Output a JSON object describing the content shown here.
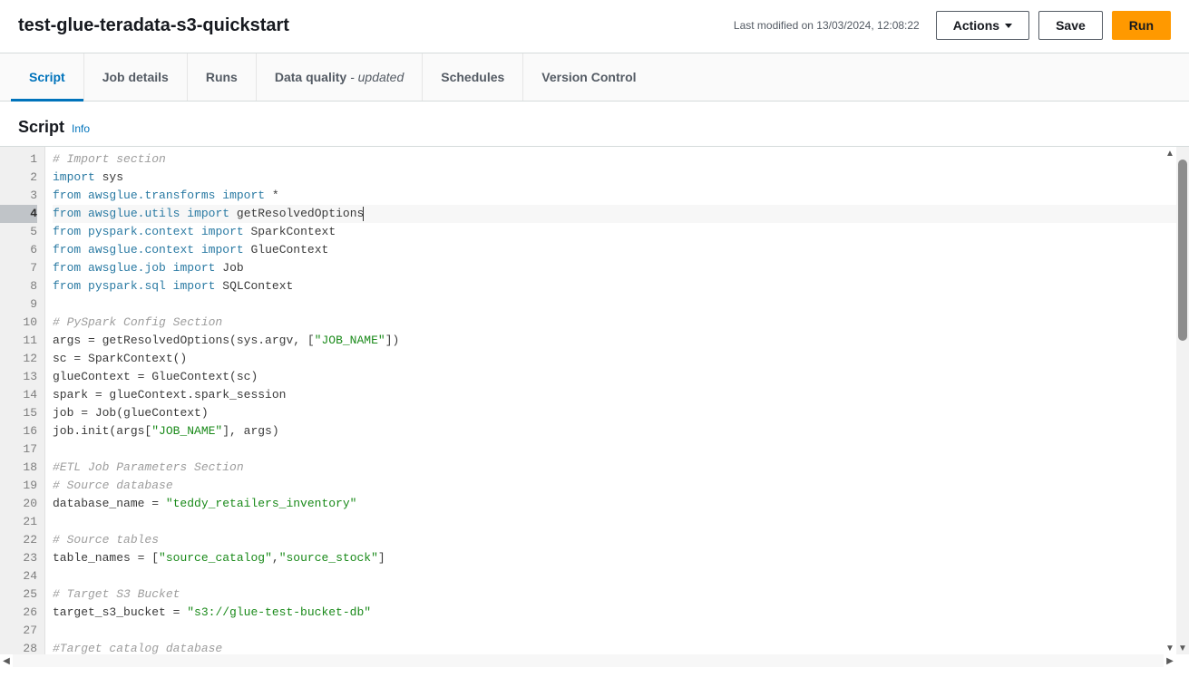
{
  "header": {
    "title": "test-glue-teradata-s3-quickstart",
    "last_modified": "Last modified on 13/03/2024, 12:08:22",
    "actions_label": "Actions",
    "save_label": "Save",
    "run_label": "Run"
  },
  "tabs": {
    "script": "Script",
    "job_details": "Job details",
    "runs": "Runs",
    "data_quality": "Data quality",
    "data_quality_suffix": " - updated",
    "schedules": "Schedules",
    "version_control": "Version Control"
  },
  "section": {
    "title": "Script",
    "info": "Info"
  },
  "editor": {
    "active_line": 4,
    "lines": [
      {
        "n": 1,
        "tokens": [
          {
            "c": "tok-comment",
            "t": "# Import section"
          }
        ]
      },
      {
        "n": 2,
        "tokens": [
          {
            "c": "tok-keyword",
            "t": "import"
          },
          {
            "c": "tok-op",
            "t": " "
          },
          {
            "c": "tok-ident",
            "t": "sys"
          }
        ]
      },
      {
        "n": 3,
        "tokens": [
          {
            "c": "tok-keyword",
            "t": "from"
          },
          {
            "c": "tok-op",
            "t": " "
          },
          {
            "c": "tok-module",
            "t": "awsglue.transforms"
          },
          {
            "c": "tok-op",
            "t": " "
          },
          {
            "c": "tok-keyword",
            "t": "import"
          },
          {
            "c": "tok-op",
            "t": " "
          },
          {
            "c": "tok-op",
            "t": "*"
          }
        ]
      },
      {
        "n": 4,
        "tokens": [
          {
            "c": "tok-keyword",
            "t": "from"
          },
          {
            "c": "tok-op",
            "t": " "
          },
          {
            "c": "tok-module",
            "t": "awsglue.utils"
          },
          {
            "c": "tok-op",
            "t": " "
          },
          {
            "c": "tok-keyword",
            "t": "import"
          },
          {
            "c": "tok-op",
            "t": " "
          },
          {
            "c": "tok-ident",
            "t": "getResolvedOptions"
          }
        ],
        "caret": true
      },
      {
        "n": 5,
        "tokens": [
          {
            "c": "tok-keyword",
            "t": "from"
          },
          {
            "c": "tok-op",
            "t": " "
          },
          {
            "c": "tok-module",
            "t": "pyspark.context"
          },
          {
            "c": "tok-op",
            "t": " "
          },
          {
            "c": "tok-keyword",
            "t": "import"
          },
          {
            "c": "tok-op",
            "t": " "
          },
          {
            "c": "tok-ident",
            "t": "SparkContext"
          }
        ]
      },
      {
        "n": 6,
        "tokens": [
          {
            "c": "tok-keyword",
            "t": "from"
          },
          {
            "c": "tok-op",
            "t": " "
          },
          {
            "c": "tok-module",
            "t": "awsglue.context"
          },
          {
            "c": "tok-op",
            "t": " "
          },
          {
            "c": "tok-keyword",
            "t": "import"
          },
          {
            "c": "tok-op",
            "t": " "
          },
          {
            "c": "tok-ident",
            "t": "GlueContext"
          }
        ]
      },
      {
        "n": 7,
        "tokens": [
          {
            "c": "tok-keyword",
            "t": "from"
          },
          {
            "c": "tok-op",
            "t": " "
          },
          {
            "c": "tok-module",
            "t": "awsglue.job"
          },
          {
            "c": "tok-op",
            "t": " "
          },
          {
            "c": "tok-keyword",
            "t": "import"
          },
          {
            "c": "tok-op",
            "t": " "
          },
          {
            "c": "tok-ident",
            "t": "Job"
          }
        ]
      },
      {
        "n": 8,
        "tokens": [
          {
            "c": "tok-keyword",
            "t": "from"
          },
          {
            "c": "tok-op",
            "t": " "
          },
          {
            "c": "tok-module",
            "t": "pyspark.sql"
          },
          {
            "c": "tok-op",
            "t": " "
          },
          {
            "c": "tok-keyword",
            "t": "import"
          },
          {
            "c": "tok-op",
            "t": " "
          },
          {
            "c": "tok-ident",
            "t": "SQLContext"
          }
        ]
      },
      {
        "n": 9,
        "tokens": [
          {
            "c": "tok-op",
            "t": " "
          }
        ]
      },
      {
        "n": 10,
        "tokens": [
          {
            "c": "tok-comment",
            "t": "# PySpark Config Section"
          }
        ]
      },
      {
        "n": 11,
        "tokens": [
          {
            "c": "tok-ident",
            "t": "args "
          },
          {
            "c": "tok-op",
            "t": "= "
          },
          {
            "c": "tok-ident",
            "t": "getResolvedOptions(sys.argv, ["
          },
          {
            "c": "tok-string",
            "t": "\"JOB_NAME\""
          },
          {
            "c": "tok-ident",
            "t": "])"
          }
        ]
      },
      {
        "n": 12,
        "tokens": [
          {
            "c": "tok-ident",
            "t": "sc "
          },
          {
            "c": "tok-op",
            "t": "= "
          },
          {
            "c": "tok-ident",
            "t": "SparkContext()"
          }
        ]
      },
      {
        "n": 13,
        "tokens": [
          {
            "c": "tok-ident",
            "t": "glueContext "
          },
          {
            "c": "tok-op",
            "t": "= "
          },
          {
            "c": "tok-ident",
            "t": "GlueContext(sc)"
          }
        ]
      },
      {
        "n": 14,
        "tokens": [
          {
            "c": "tok-ident",
            "t": "spark "
          },
          {
            "c": "tok-op",
            "t": "= "
          },
          {
            "c": "tok-ident",
            "t": "glueContext.spark_session"
          }
        ]
      },
      {
        "n": 15,
        "tokens": [
          {
            "c": "tok-ident",
            "t": "job "
          },
          {
            "c": "tok-op",
            "t": "= "
          },
          {
            "c": "tok-ident",
            "t": "Job(glueContext)"
          }
        ]
      },
      {
        "n": 16,
        "tokens": [
          {
            "c": "tok-ident",
            "t": "job.init(args["
          },
          {
            "c": "tok-string",
            "t": "\"JOB_NAME\""
          },
          {
            "c": "tok-ident",
            "t": "], args)"
          }
        ]
      },
      {
        "n": 17,
        "tokens": [
          {
            "c": "tok-op",
            "t": " "
          }
        ]
      },
      {
        "n": 18,
        "tokens": [
          {
            "c": "tok-comment",
            "t": "#ETL Job Parameters Section"
          }
        ]
      },
      {
        "n": 19,
        "tokens": [
          {
            "c": "tok-comment",
            "t": "# Source database"
          }
        ]
      },
      {
        "n": 20,
        "tokens": [
          {
            "c": "tok-ident",
            "t": "database_name "
          },
          {
            "c": "tok-op",
            "t": "= "
          },
          {
            "c": "tok-string",
            "t": "\"teddy_retailers_inventory\""
          }
        ]
      },
      {
        "n": 21,
        "tokens": [
          {
            "c": "tok-op",
            "t": " "
          }
        ]
      },
      {
        "n": 22,
        "tokens": [
          {
            "c": "tok-comment",
            "t": "# Source tables"
          }
        ]
      },
      {
        "n": 23,
        "tokens": [
          {
            "c": "tok-ident",
            "t": "table_names "
          },
          {
            "c": "tok-op",
            "t": "= "
          },
          {
            "c": "tok-ident",
            "t": "["
          },
          {
            "c": "tok-string",
            "t": "\"source_catalog\""
          },
          {
            "c": "tok-ident",
            "t": ","
          },
          {
            "c": "tok-string",
            "t": "\"source_stock\""
          },
          {
            "c": "tok-ident",
            "t": "]"
          }
        ]
      },
      {
        "n": 24,
        "tokens": [
          {
            "c": "tok-op",
            "t": " "
          }
        ]
      },
      {
        "n": 25,
        "tokens": [
          {
            "c": "tok-comment",
            "t": "# Target S3 Bucket"
          }
        ]
      },
      {
        "n": 26,
        "tokens": [
          {
            "c": "tok-ident",
            "t": "target_s3_bucket "
          },
          {
            "c": "tok-op",
            "t": "= "
          },
          {
            "c": "tok-string",
            "t": "\"s3://glue-test-bucket-db\""
          }
        ]
      },
      {
        "n": 27,
        "tokens": [
          {
            "c": "tok-op",
            "t": " "
          }
        ]
      },
      {
        "n": 28,
        "tokens": [
          {
            "c": "tok-comment",
            "t": "#Target catalog database"
          }
        ]
      }
    ]
  }
}
